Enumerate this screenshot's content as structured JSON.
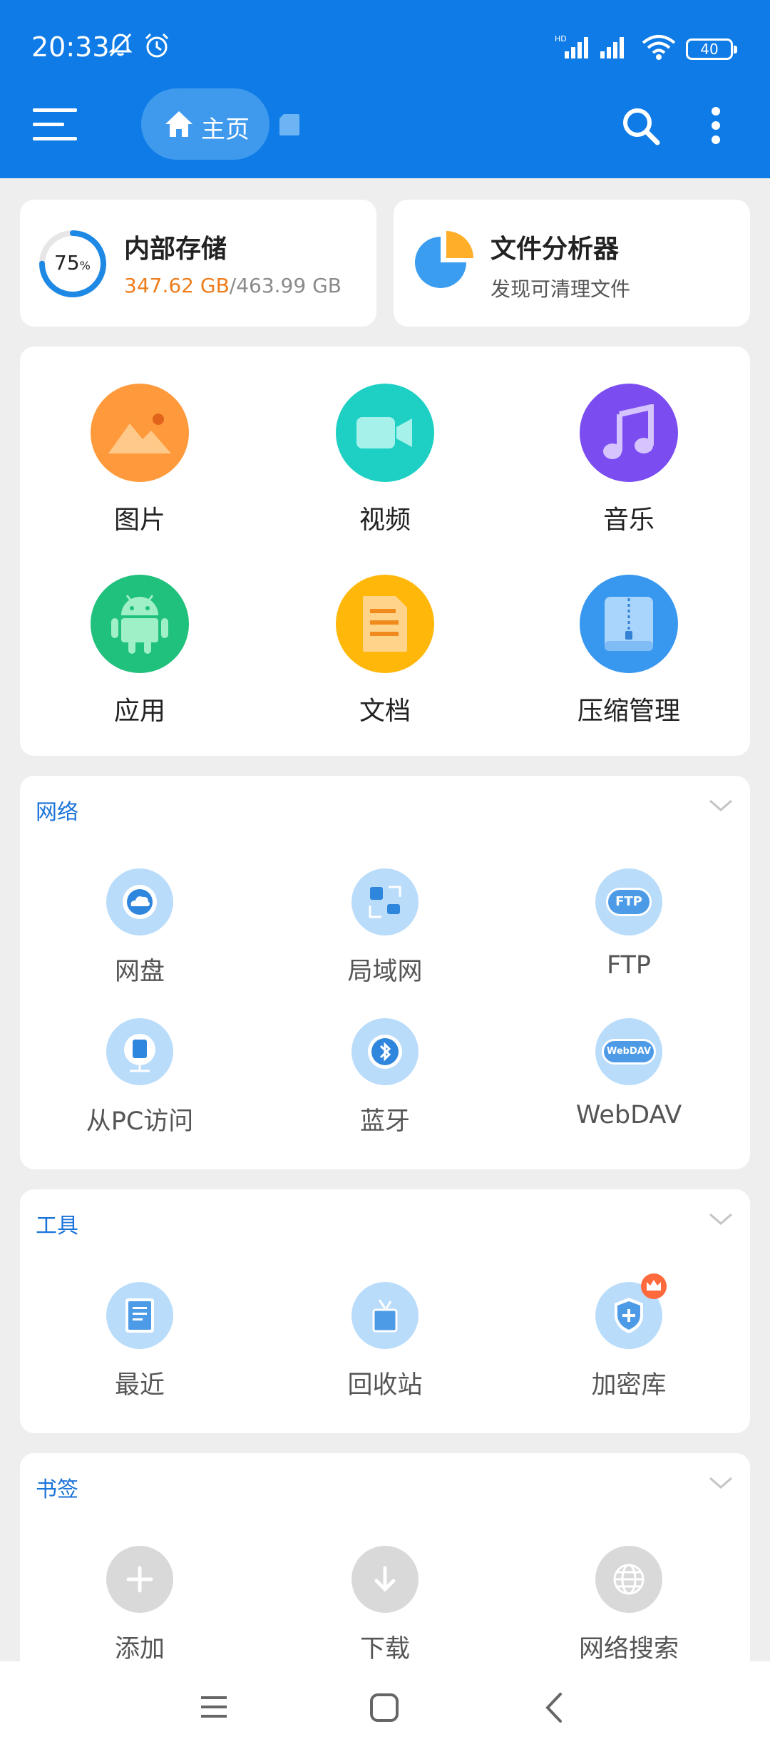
{
  "status": {
    "time": "20:33",
    "battery": "40"
  },
  "toolbar": {
    "home_label": "主页"
  },
  "storage": {
    "title": "内部存储",
    "percent": "75",
    "percent_sign": "%",
    "used": "347.62 GB",
    "total": "/463.99 GB",
    "fraction_used": 0.75
  },
  "analyzer": {
    "title": "文件分析器",
    "subtitle": "发现可清理文件"
  },
  "categories": [
    {
      "label": "图片",
      "color": "#ff9a3c"
    },
    {
      "label": "视频",
      "color": "#1dd0c3"
    },
    {
      "label": "音乐",
      "color": "#7b4df0"
    },
    {
      "label": "应用",
      "color": "#20c07d"
    },
    {
      "label": "文档",
      "color": "#ffb70a"
    },
    {
      "label": "压缩管理",
      "color": "#3897ef"
    }
  ],
  "network": {
    "title": "网络",
    "items": [
      {
        "label": "网盘",
        "icon": "cloud-drive-icon"
      },
      {
        "label": "局域网",
        "icon": "lan-icon"
      },
      {
        "label": "FTP",
        "icon": "ftp-icon"
      },
      {
        "label": "从PC访问",
        "icon": "pc-access-icon"
      },
      {
        "label": "蓝牙",
        "icon": "bluetooth-icon"
      },
      {
        "label": "WebDAV",
        "icon": "webdav-icon"
      }
    ],
    "ftp_badge": "FTP",
    "webdav_badge": "WebDAV"
  },
  "tools": {
    "title": "工具",
    "items": [
      {
        "label": "最近",
        "icon": "recent-icon"
      },
      {
        "label": "回收站",
        "icon": "recycle-bin-icon"
      },
      {
        "label": "加密库",
        "icon": "vault-icon"
      }
    ]
  },
  "bookmarks": {
    "title": "书签",
    "items": [
      {
        "label": "添加",
        "icon": "add-icon"
      },
      {
        "label": "下载",
        "icon": "download-icon"
      },
      {
        "label": "网络搜索",
        "icon": "web-search-icon"
      }
    ]
  },
  "colors": {
    "brand": "#0f7be6",
    "accent_orange": "#ee7d1c",
    "section_title": "#1a73d9"
  }
}
